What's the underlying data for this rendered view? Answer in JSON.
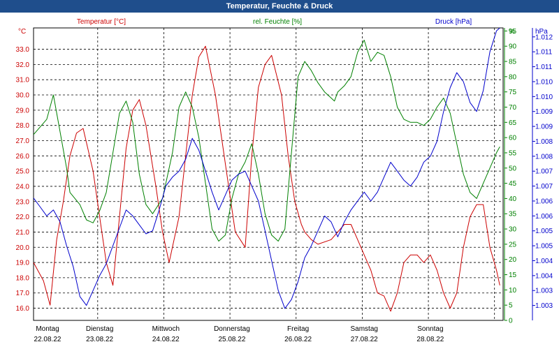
{
  "window": {
    "title": "Temperatur, Feuchte & Druck"
  },
  "chart_data": {
    "type": "line",
    "title": "Temperatur, Feuchte & Druck",
    "grid": true,
    "x_ticks": [
      {
        "day": "Montag",
        "date": "22.08.22"
      },
      {
        "day": "Dienstag",
        "date": "23.08.22"
      },
      {
        "day": "Mittwoch",
        "date": "24.08.22"
      },
      {
        "day": "Donnerstag",
        "date": "25.08.22"
      },
      {
        "day": "Freitag",
        "date": "26.08.22"
      },
      {
        "day": "Samstag",
        "date": "27.08.22"
      },
      {
        "day": "Sonntag",
        "date": "28.08.22"
      }
    ],
    "x_range": [
      0,
      7.1
    ],
    "axes": {
      "temperature": {
        "unit": "°C",
        "range": [
          15.2,
          34.4
        ],
        "ticks": [
          "16.0",
          "17.0",
          "18.0",
          "19.0",
          "20.0",
          "21.0",
          "22.0",
          "23.0",
          "24.0",
          "25.0",
          "26.0",
          "27.0",
          "28.0",
          "29.0",
          "30.0",
          "31.0",
          "32.0",
          "33.0"
        ],
        "color": "#cc0000"
      },
      "humidity": {
        "unit": "%",
        "range": [
          0,
          96
        ],
        "ticks": [
          "0",
          "5",
          "10",
          "15",
          "20",
          "25",
          "30",
          "35",
          "40",
          "45",
          "50",
          "55",
          "60",
          "65",
          "70",
          "75",
          "80",
          "85",
          "90",
          "95",
          "%"
        ],
        "color": "#008000"
      },
      "pressure": {
        "unit": "hPa",
        "range": [
          1002.5,
          1012.3
        ],
        "ticks": [
          "1.003",
          "1.003",
          "1.004",
          "1.004",
          "1.005",
          "1.005",
          "1.006",
          "1.006",
          "1.007",
          "1.007",
          "1.008",
          "1.008",
          "1.009",
          "1.009",
          "1.010",
          "1.010",
          "1.011",
          "1.011",
          "1.012",
          "1.012"
        ],
        "tick_values": [
          1003.0,
          1003.5,
          1004.0,
          1004.5,
          1005.0,
          1005.5,
          1006.0,
          1006.5,
          1007.0,
          1007.5,
          1008.0,
          1008.5,
          1009.0,
          1009.5,
          1010.0,
          1010.5,
          1011.0,
          1011.5,
          1012.0,
          1012.5
        ],
        "color": "#0000cc"
      }
    },
    "series": [
      {
        "name": "Temperatur [°C]",
        "axis": "temperature",
        "color": "#cc0000",
        "x": [
          0,
          0.15,
          0.25,
          0.35,
          0.45,
          0.55,
          0.65,
          0.75,
          0.9,
          1.0,
          1.1,
          1.2,
          1.3,
          1.4,
          1.5,
          1.6,
          1.7,
          1.85,
          1.95,
          2.05,
          2.2,
          2.3,
          2.4,
          2.5,
          2.6,
          2.75,
          2.85,
          2.95,
          3.05,
          3.2,
          3.3,
          3.4,
          3.5,
          3.6,
          3.75,
          3.85,
          3.95,
          4.05,
          4.1,
          4.2,
          4.3,
          4.5,
          4.7,
          4.8,
          4.9,
          5.0,
          5.1,
          5.2,
          5.3,
          5.4,
          5.5,
          5.6,
          5.7,
          5.8,
          5.9,
          6.0,
          6.1,
          6.2,
          6.3,
          6.4,
          6.5,
          6.6,
          6.7,
          6.8,
          6.9,
          7.0,
          7.05
        ],
        "values": [
          19.0,
          17.8,
          16.2,
          20.5,
          23.0,
          26.0,
          27.5,
          27.8,
          25.0,
          22.0,
          19.0,
          17.5,
          22.0,
          26.5,
          29.0,
          29.7,
          28.0,
          24.0,
          21.0,
          19.0,
          22.0,
          26.0,
          30.0,
          32.5,
          33.2,
          30.0,
          27.0,
          24.0,
          21.0,
          20.0,
          26.0,
          30.5,
          32.0,
          32.6,
          30.0,
          26.0,
          23.0,
          21.5,
          21.0,
          20.5,
          20.2,
          20.5,
          21.5,
          21.5,
          20.5,
          19.5,
          18.5,
          17.0,
          16.8,
          15.8,
          17.0,
          19.0,
          19.5,
          19.5,
          19.0,
          19.5,
          18.5,
          17.0,
          16.0,
          17.0,
          20.0,
          22.0,
          22.8,
          22.8,
          20.0,
          18.5,
          17.5
        ]
      },
      {
        "name": "rel. Feuchte [%]",
        "axis": "humidity",
        "color": "#008000",
        "x": [
          0,
          0.2,
          0.3,
          0.4,
          0.5,
          0.55,
          0.7,
          0.8,
          0.9,
          1.0,
          1.1,
          1.2,
          1.3,
          1.4,
          1.5,
          1.6,
          1.7,
          1.8,
          1.95,
          2.1,
          2.2,
          2.3,
          2.4,
          2.5,
          2.6,
          2.7,
          2.8,
          2.9,
          3.0,
          3.1,
          3.2,
          3.3,
          3.4,
          3.5,
          3.6,
          3.7,
          3.8,
          3.9,
          4.0,
          4.1,
          4.2,
          4.3,
          4.4,
          4.5,
          4.55,
          4.6,
          4.7,
          4.8,
          4.9,
          5.0,
          5.1,
          5.2,
          5.3,
          5.4,
          5.5,
          5.6,
          5.7,
          5.8,
          5.9,
          6.0,
          6.1,
          6.2,
          6.3,
          6.4,
          6.5,
          6.6,
          6.7,
          6.8,
          6.9,
          7.0,
          7.05
        ],
        "values": [
          61,
          66,
          74,
          62,
          50,
          42,
          38,
          33,
          32,
          36,
          42,
          55,
          68,
          72,
          65,
          48,
          38,
          35,
          40,
          55,
          70,
          75,
          70,
          60,
          45,
          30,
          26,
          28,
          40,
          48,
          52,
          58,
          48,
          35,
          28,
          26,
          30,
          55,
          80,
          85,
          82,
          78,
          75,
          73,
          72,
          75,
          77,
          80,
          88,
          92,
          85,
          88,
          87,
          80,
          70,
          66,
          65,
          65,
          64,
          66,
          70,
          73,
          68,
          58,
          48,
          42,
          40,
          45,
          50,
          55,
          57
        ]
      },
      {
        "name": "Druck [hPa]",
        "axis": "pressure",
        "color": "#0000cc",
        "x": [
          0,
          0.1,
          0.2,
          0.3,
          0.4,
          0.5,
          0.6,
          0.7,
          0.8,
          0.9,
          1.0,
          1.1,
          1.2,
          1.3,
          1.4,
          1.5,
          1.6,
          1.7,
          1.8,
          1.9,
          2.0,
          2.1,
          2.2,
          2.3,
          2.4,
          2.5,
          2.6,
          2.7,
          2.8,
          2.9,
          3.0,
          3.1,
          3.2,
          3.3,
          3.4,
          3.5,
          3.6,
          3.7,
          3.8,
          3.9,
          4.0,
          4.1,
          4.2,
          4.3,
          4.4,
          4.5,
          4.6,
          4.7,
          4.8,
          4.9,
          5.0,
          5.1,
          5.2,
          5.3,
          5.4,
          5.5,
          5.6,
          5.7,
          5.8,
          5.9,
          6.0,
          6.1,
          6.2,
          6.3,
          6.4,
          6.5,
          6.6,
          6.7,
          6.8,
          6.9,
          7.0,
          7.05
        ],
        "values": [
          1006.6,
          1006.3,
          1006.0,
          1006.2,
          1005.8,
          1005.0,
          1004.3,
          1003.3,
          1003.0,
          1003.5,
          1004.0,
          1004.4,
          1005.0,
          1005.6,
          1006.2,
          1006.0,
          1005.7,
          1005.4,
          1005.5,
          1006.2,
          1007.0,
          1007.3,
          1007.5,
          1007.9,
          1008.6,
          1008.2,
          1007.5,
          1006.8,
          1006.2,
          1006.7,
          1007.2,
          1007.4,
          1007.5,
          1007.0,
          1006.5,
          1005.5,
          1004.5,
          1003.5,
          1002.9,
          1003.2,
          1003.8,
          1004.6,
          1005.0,
          1005.5,
          1006.0,
          1005.8,
          1005.3,
          1005.8,
          1006.2,
          1006.5,
          1006.8,
          1006.5,
          1006.8,
          1007.3,
          1007.8,
          1007.5,
          1007.2,
          1007.0,
          1007.3,
          1007.8,
          1008.0,
          1008.5,
          1009.5,
          1010.3,
          1010.8,
          1010.5,
          1009.8,
          1009.5,
          1010.2,
          1011.5,
          1012.2,
          1012.3
        ]
      }
    ]
  }
}
